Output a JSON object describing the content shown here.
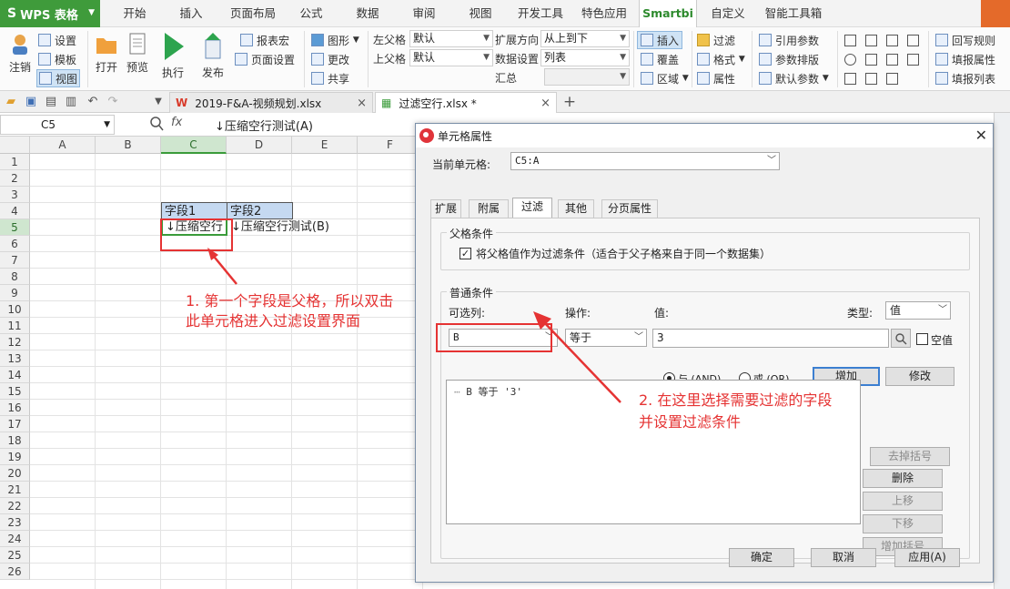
{
  "app": {
    "name": "WPS 表格"
  },
  "menu": {
    "items": [
      "开始",
      "插入",
      "页面布局",
      "公式",
      "数据",
      "审阅",
      "视图",
      "开发工具",
      "特色应用",
      "Smartbi",
      "自定义",
      "智能工具箱"
    ],
    "active": "Smartbi"
  },
  "ribbon": {
    "logout": "注销",
    "settings": "设置",
    "template": "模板",
    "view": "视图",
    "open": "打开",
    "preview": "预览",
    "execute": "执行",
    "publish": "发布",
    "report_macro": "报表宏",
    "page_setup": "页面设置",
    "chart": "图形",
    "change": "更改",
    "share": "共享",
    "left_parent_label": "左父格",
    "left_parent_value": "默认",
    "top_parent_label": "上父格",
    "top_parent_value": "默认",
    "expand_dir_label": "扩展方向",
    "expand_dir_value": "从上到下",
    "data_setting_label": "数据设置",
    "data_setting_value": "列表",
    "summary_label": "汇总",
    "insert": "插入",
    "cover": "覆盖",
    "region": "区域",
    "filter": "过滤",
    "format": "格式",
    "property": "属性",
    "ref_param": "引用参数",
    "param_layout": "参数排版",
    "default_param": "默认参数",
    "writeback_rule": "回写规则",
    "fill_property": "填报属性",
    "fill_list": "填报列表"
  },
  "doc_tabs": [
    {
      "label": "2019-F&A-视频规划.xlsx"
    },
    {
      "label": "过滤空行.xlsx *"
    }
  ],
  "formula": {
    "cell_ref": "C5",
    "fx": "fx",
    "content": "↓压缩空行测试(A)"
  },
  "sheet": {
    "columns": [
      "A",
      "B",
      "C",
      "D",
      "E",
      "F"
    ],
    "rows": [
      "1",
      "2",
      "3",
      "4",
      "5",
      "6",
      "7",
      "8",
      "9",
      "10",
      "11",
      "12",
      "13",
      "14",
      "15",
      "16",
      "17",
      "18",
      "19",
      "20",
      "21",
      "22",
      "23",
      "24",
      "25",
      "26"
    ],
    "c4": "字段1",
    "d4": "字段2",
    "c5": "↓压缩空行",
    "d5": "↓压缩空行测试(B)"
  },
  "annotations": {
    "note1_line1": "1. 第一个字段是父格，所以双击",
    "note1_line2": "此单元格进入过滤设置界面",
    "note2_line1": "2. 在这里选择需要过滤的字段",
    "note2_line2": "并设置过滤条件"
  },
  "dialog": {
    "title": "单元格属性",
    "current_cell_label": "当前单元格:",
    "current_cell_value": "C5:A",
    "tabs": [
      "扩展",
      "附属",
      "过滤",
      "其他",
      "分页属性"
    ],
    "active_tab": "过滤",
    "parent_group_title": "父格条件",
    "parent_checkbox_label": "将父格值作为过滤条件（适合于父子格来自于同一个数据集）",
    "parent_checkbox_checked": true,
    "normal_group_title": "普通条件",
    "column_label": "可选列:",
    "op_label": "操作:",
    "value_label": "值:",
    "type_label": "类型:",
    "type_value": "值",
    "column_value": "B",
    "op_value": "等于",
    "value_value": "3",
    "empty_label": "空值",
    "and_label": "与 (AND)",
    "or_label": "或 (OR)",
    "add_button": "增加",
    "modify_button": "修改",
    "condition_item": "B 等于 '3'",
    "delete_button": "删除",
    "up_button": "上移",
    "down_button": "下移",
    "add_bracket_button": "增加括号",
    "remove_bracket_button": "去掉括号",
    "ok_button": "确定",
    "cancel_button": "取消",
    "apply_button": "应用(A)"
  },
  "colors": {
    "accent": "#3f9b3b",
    "annotation": "#e53333",
    "header_fill": "#c5d9f1"
  }
}
